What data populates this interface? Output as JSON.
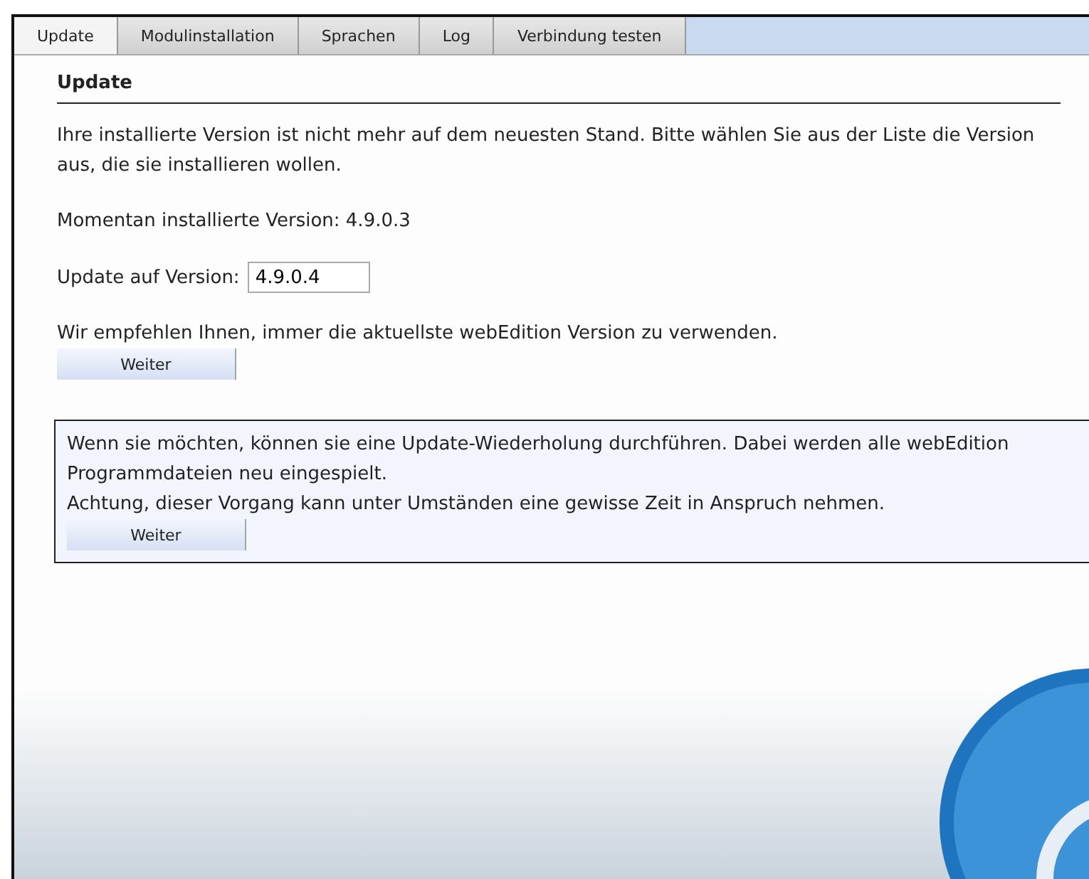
{
  "tabs": [
    {
      "label": "Update",
      "selected": true
    },
    {
      "label": "Modulinstallation",
      "selected": false
    },
    {
      "label": "Sprachen",
      "selected": false
    },
    {
      "label": "Log",
      "selected": false
    },
    {
      "label": "Verbindung testen",
      "selected": false
    }
  ],
  "heading": "Update",
  "intro": "Ihre installierte Version ist nicht mehr auf dem neuesten Stand. Bitte wählen Sie aus der Liste die Version aus, die sie installieren wollen.",
  "installed": "Momentan installierte Version: 4.9.0.3",
  "update_label": "Update auf Version:",
  "update_value": "4.9.0.4",
  "recommendation": "Wir empfehlen Ihnen, immer die aktuellste webEdition Version zu verwenden.",
  "button": "Weiter",
  "repeat_box": {
    "paragraphs": [
      "Wenn sie möchten, können sie eine Update-Wiederholung durchführen. Dabei werden alle webEdition Programmdateien neu eingespielt.",
      "Achtung, dieser Vorgang kann unter Umständen eine gewisse Zeit in Anspruch nehmen."
    ],
    "button": "Weiter"
  }
}
